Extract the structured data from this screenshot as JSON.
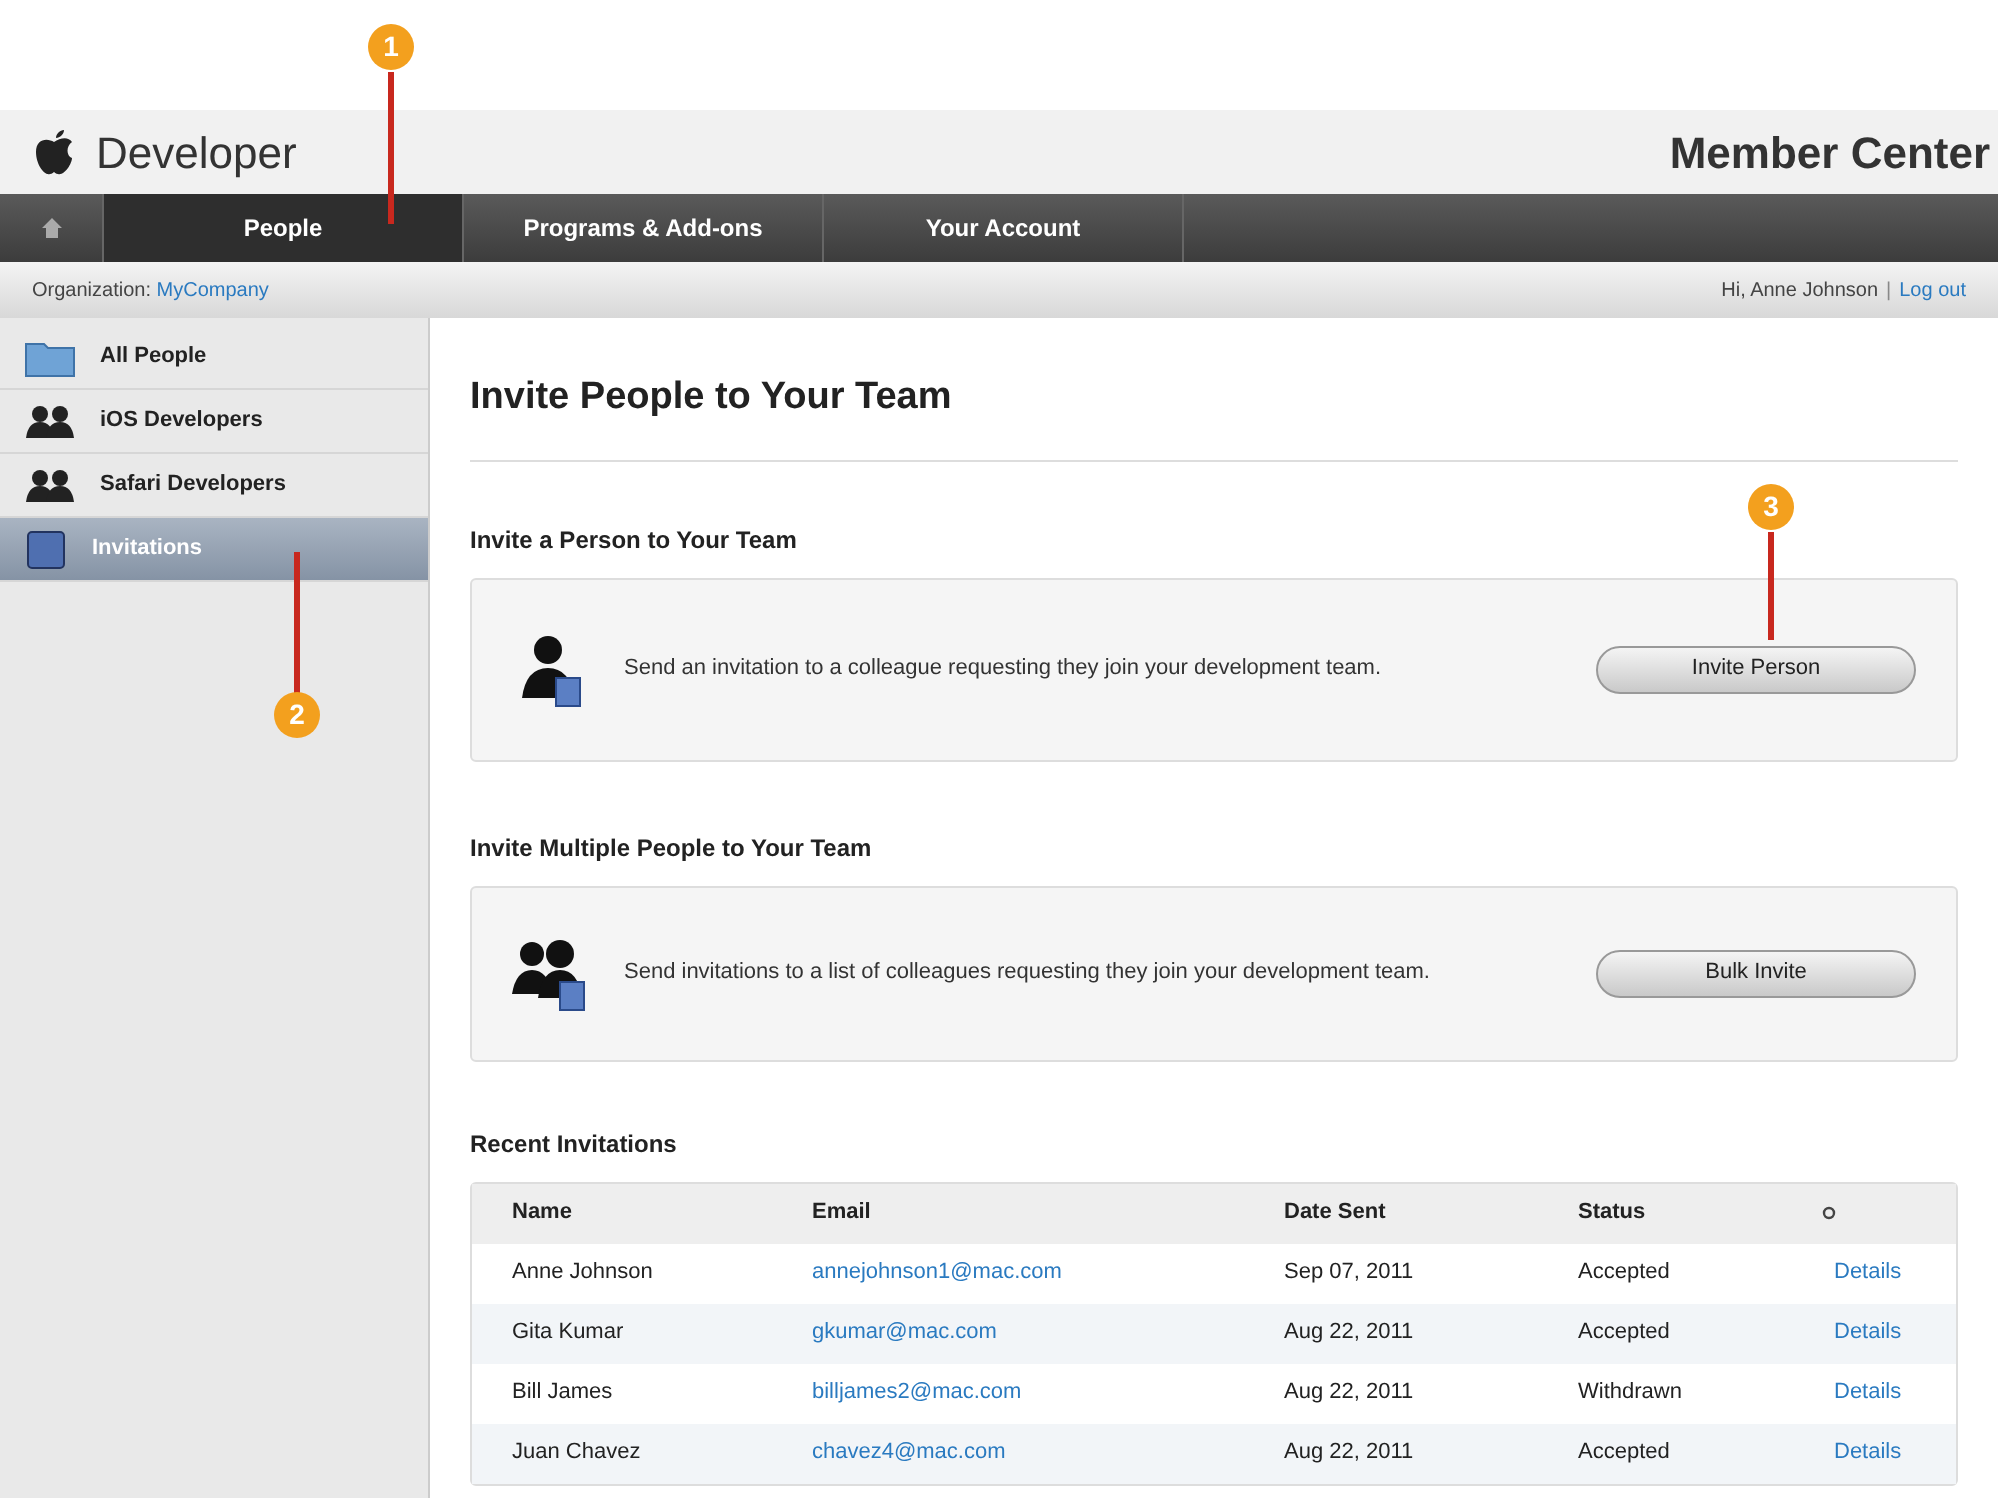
{
  "header": {
    "brand": "Developer",
    "title": "Member Center"
  },
  "nav": [
    {
      "kind": "home",
      "selected": false
    },
    {
      "kind": "text",
      "label": "People",
      "selected": true
    },
    {
      "kind": "text",
      "label": "Programs & Add-ons",
      "selected": false
    },
    {
      "kind": "text",
      "label": "Your Account",
      "selected": false
    }
  ],
  "org_bar": {
    "label": "Organization:",
    "org": "MyCompany",
    "greeting": "Hi, Anne Johnson",
    "separator": "|",
    "logout": "Log out"
  },
  "sidebar": {
    "items": [
      {
        "kind": "folder",
        "label": "All People",
        "selected": false
      },
      {
        "kind": "group",
        "label": "iOS Developers",
        "selected": false
      },
      {
        "kind": "group",
        "label": "Safari Developers",
        "selected": false
      },
      {
        "kind": "card",
        "label": "Invitations",
        "selected": true
      }
    ]
  },
  "page_title": "Invite People to Your Team",
  "sections": [
    {
      "kind": "single",
      "heading": "Invite a Person to Your Team",
      "text": "Send an invitation to a colleague requesting they join your development team.",
      "button": "Invite Person"
    },
    {
      "kind": "multiple",
      "heading": "Invite Multiple People to Your Team",
      "text": "Send invitations to a list of colleagues requesting they join your development team.",
      "button": "Bulk Invite"
    }
  ],
  "recent": {
    "heading": "Recent Invitations",
    "columns": [
      "Name",
      "Email",
      "Date Sent",
      "Status"
    ],
    "rows": [
      {
        "name": "Anne Johnson",
        "email": "annejohnson1@mac.com",
        "date": "Sep 07, 2011",
        "status": "Accepted",
        "action": "Details"
      },
      {
        "name": "Gita Kumar",
        "email": "gkumar@mac.com",
        "date": "Aug 22, 2011",
        "status": "Accepted",
        "action": "Details"
      },
      {
        "name": "Bill James",
        "email": "billjames2@mac.com",
        "date": "Aug 22, 2011",
        "status": "Withdrawn",
        "action": "Details"
      },
      {
        "name": "Juan Chavez",
        "email": "chavez4@mac.com",
        "date": "Aug 22, 2011",
        "status": "Accepted",
        "action": "Details"
      }
    ]
  },
  "callouts": [
    {
      "label": "1"
    },
    {
      "label": "2"
    },
    {
      "label": "3"
    }
  ]
}
